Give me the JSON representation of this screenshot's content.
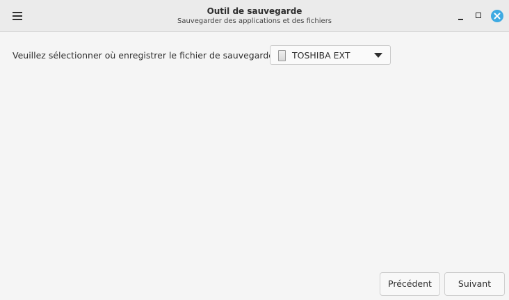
{
  "window": {
    "title": "Outil de sauvegarde",
    "subtitle": "Sauvegarder des applications et des fichiers",
    "accent_color": "#3eaae2"
  },
  "header": {
    "menu_icon": "hamburger-menu-icon",
    "controls": {
      "minimize_icon": "minimize-icon",
      "maximize_icon": "maximize-icon",
      "close_icon": "close-icon"
    }
  },
  "main": {
    "prompt": "Veuillez sélectionner où enregistrer le fichier de sauvegarde :",
    "destination": {
      "icon": "drive-icon",
      "selected_value": "TOSHIBA EXT",
      "dropdown_icon": "chevron-down-icon"
    }
  },
  "footer": {
    "previous_label": "Précédent",
    "next_label": "Suivant"
  }
}
